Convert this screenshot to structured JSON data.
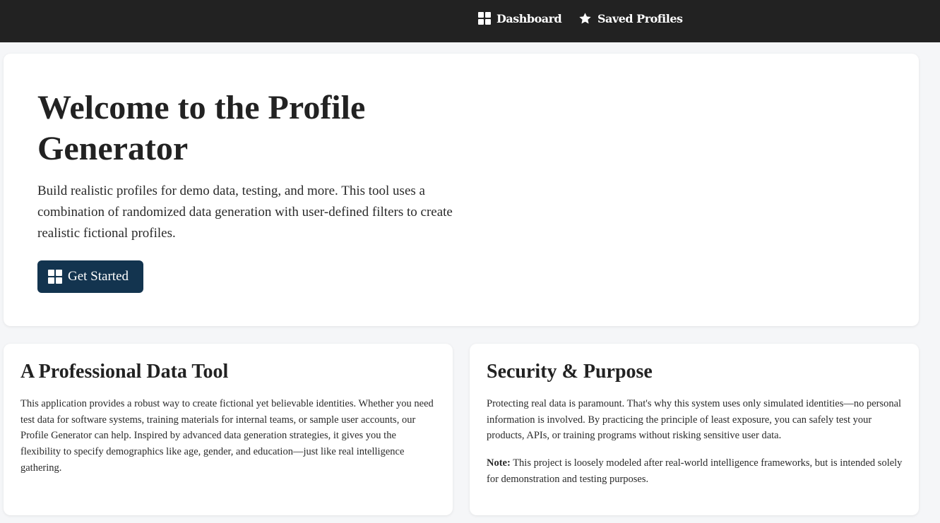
{
  "nav": {
    "items": [
      {
        "label": "Dashboard",
        "icon": "grid-icon"
      },
      {
        "label": "Saved Profiles",
        "icon": "star-icon"
      }
    ]
  },
  "hero": {
    "title": "Welcome to the Profile Generator",
    "description": "Build realistic profiles for demo data, testing, and more. This tool uses a combination of randomized data generation with user-defined filters to create realistic fictional profiles.",
    "button_label": "Get Started",
    "button_icon": "grid-icon",
    "button_color": "#13344f"
  },
  "cards": [
    {
      "title": "A Professional Data Tool",
      "body": "This application provides a robust way to create fictional yet believable identities. Whether you need test data for software systems, training materials for internal teams, or sample user accounts, our Profile Generator can help. Inspired by advanced data generation strategies, it gives you the flexibility to specify demographics like age, gender, and education—just like real intelligence gathering."
    },
    {
      "title": "Security & Purpose",
      "body": "Protecting real data is paramount. That's why this system uses only simulated identities—no personal information is involved. By practicing the principle of least exposure, you can safely test your products, APIs, or training programs without risking sensitive user data.",
      "note_label": "Note:",
      "note_text": " This project is loosely modeled after real-world intelligence frameworks, but is intended solely for demonstration and testing purposes."
    }
  ],
  "colors": {
    "navbar": "#222222",
    "background": "#f5f6f8",
    "card": "#ffffff"
  }
}
